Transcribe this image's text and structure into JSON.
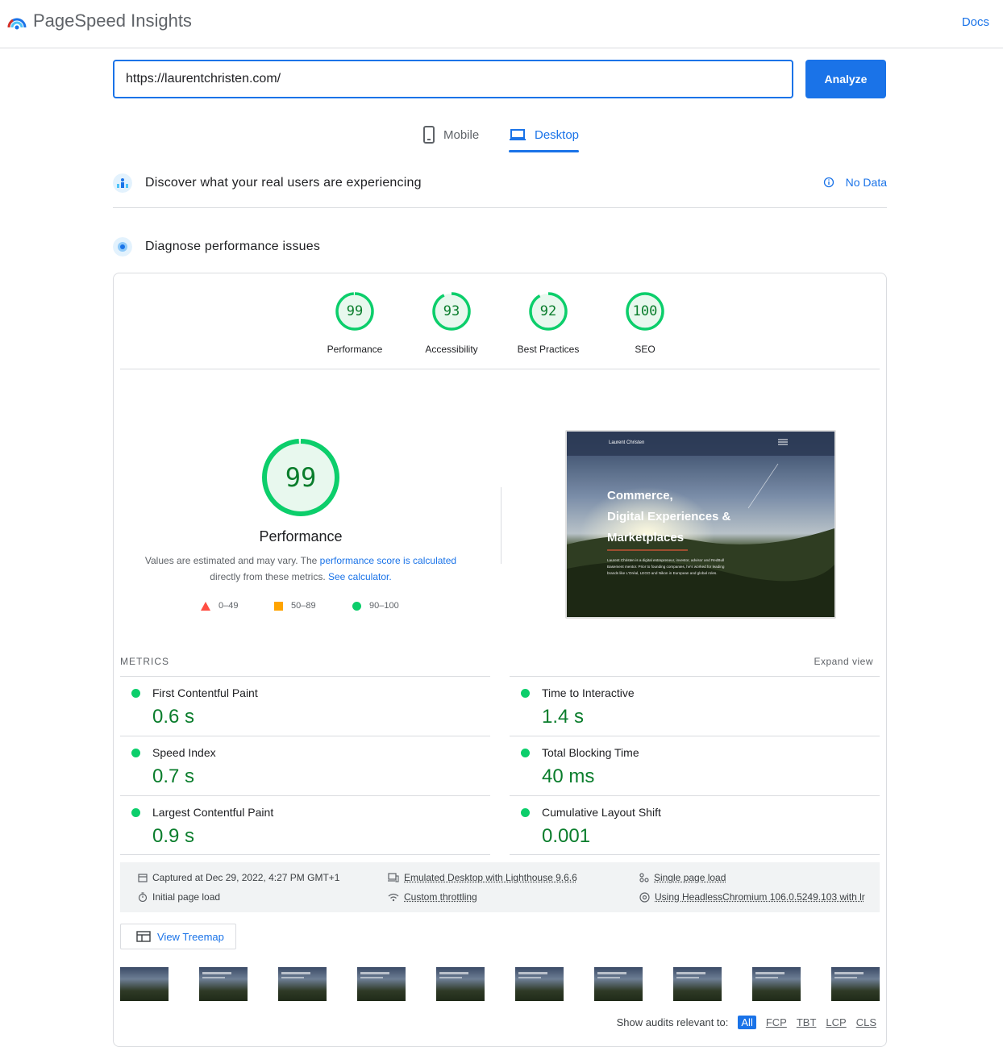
{
  "header": {
    "app_title": "PageSpeed Insights",
    "docs_label": "Docs"
  },
  "search": {
    "url_value": "https://laurentchristen.com/",
    "analyze_label": "Analyze"
  },
  "tabs": [
    {
      "label": "Mobile"
    },
    {
      "label": "Desktop",
      "selected": true
    }
  ],
  "real_users": {
    "title": "Discover what your real users are experiencing",
    "status": "No Data"
  },
  "diagnose": {
    "title": "Diagnose performance issues"
  },
  "scores": [
    {
      "label": "Performance",
      "value": "99"
    },
    {
      "label": "Accessibility",
      "value": "93"
    },
    {
      "label": "Best Practices",
      "value": "92"
    },
    {
      "label": "SEO",
      "value": "100"
    }
  ],
  "main_score": {
    "value": "99",
    "label": "Performance",
    "note_pre": "Values are estimated and may vary. The ",
    "note_link": "performance score is calculated",
    "note_mid": "directly from these metrics. ",
    "note_link2": "See calculator.",
    "legend": [
      {
        "range": "0–49",
        "color": "#ff4e42"
      },
      {
        "range": "50–89",
        "color": "#ffa400"
      },
      {
        "range": "90–100",
        "color": "#0cce6b"
      }
    ]
  },
  "preview": {
    "brand": "Laurent Christen",
    "headline_1": "Commerce,",
    "headline_2": "Digital Experiences &",
    "headline_3": "Marketplaces",
    "body": "Laurent Christen is a digital entrepreneur, investor, advisor and RedBull Basement mentor. Prior to founding companies, he's worked for leading brands like L'Oréal, LEGO and Nikon in European and global roles."
  },
  "metrics": {
    "heading": "METRICS",
    "expand_label": "Expand view",
    "items": [
      {
        "name": "First Contentful Paint",
        "value": "0.6 s"
      },
      {
        "name": "Time to Interactive",
        "value": "1.4 s"
      },
      {
        "name": "Speed Index",
        "value": "0.7 s"
      },
      {
        "name": "Total Blocking Time",
        "value": "40 ms"
      },
      {
        "name": "Largest Contentful Paint",
        "value": "0.9 s"
      },
      {
        "name": "Cumulative Layout Shift",
        "value": "0.001"
      }
    ]
  },
  "run_info": {
    "captured": "Captured at Dec 29, 2022, 4:27 PM GMT+1",
    "initial_load": "Initial page load",
    "emulated": "Emulated Desktop with Lighthouse 9.6.6",
    "throttling": "Custom throttling",
    "single_load": "Single page load",
    "browser": "Using HeadlessChromium 106.0.5249.103 with lr"
  },
  "treemap_label": "View Treemap",
  "audits_filter": {
    "label": "Show audits relevant to:",
    "options": [
      "All",
      "FCP",
      "TBT",
      "LCP",
      "CLS"
    ]
  },
  "colors": {
    "accent": "#1a73e8",
    "pass": "#0cce6b",
    "pass_text": "#0a7d2c"
  }
}
